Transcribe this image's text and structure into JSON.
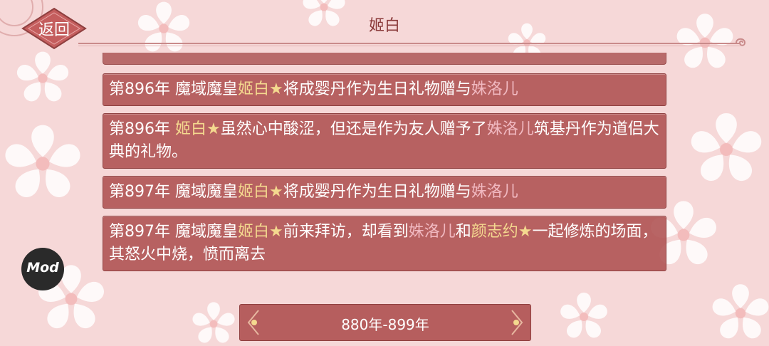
{
  "header": {
    "title": "姬白",
    "back_label": "返回"
  },
  "mod_button": {
    "label": "Mod"
  },
  "range": {
    "label": "880年-899年"
  },
  "entries": [
    {
      "segments": [
        {
          "text": "第896年 魔域魔皇",
          "style": "plain"
        },
        {
          "text": "姬白★",
          "style": "gold"
        },
        {
          "text": "将成婴丹作为生日礼物赠与",
          "style": "plain"
        },
        {
          "text": "姝洛儿",
          "style": "pink"
        }
      ]
    },
    {
      "segments": [
        {
          "text": "第896年 ",
          "style": "plain"
        },
        {
          "text": "姬白★",
          "style": "gold"
        },
        {
          "text": "虽然心中酸涩，但还是作为友人赠予了",
          "style": "plain"
        },
        {
          "text": "姝洛儿",
          "style": "pink"
        },
        {
          "text": "筑基丹作为道侣大典的礼物。",
          "style": "plain"
        }
      ]
    },
    {
      "segments": [
        {
          "text": "第897年 魔域魔皇",
          "style": "plain"
        },
        {
          "text": "姬白★",
          "style": "gold"
        },
        {
          "text": "将成婴丹作为生日礼物赠与",
          "style": "plain"
        },
        {
          "text": "姝洛儿",
          "style": "pink"
        }
      ]
    },
    {
      "segments": [
        {
          "text": "第897年 魔域魔皇",
          "style": "plain"
        },
        {
          "text": "姬白★",
          "style": "gold"
        },
        {
          "text": "前来拜访，却看到",
          "style": "plain"
        },
        {
          "text": "姝洛儿",
          "style": "pink"
        },
        {
          "text": "和",
          "style": "plain"
        },
        {
          "text": "颜志约★",
          "style": "gold"
        },
        {
          "text": "一起修炼的场面，其怒火中烧，愤而离去",
          "style": "plain"
        }
      ]
    }
  ]
}
